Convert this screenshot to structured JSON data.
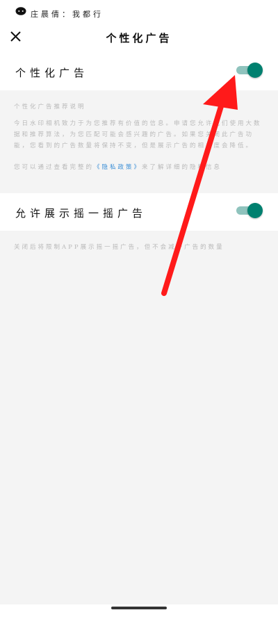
{
  "status_bar": {
    "text": "庄晨倩：我都行"
  },
  "navbar": {
    "title": "个性化广告"
  },
  "personalized_ads": {
    "label": "个性化广告",
    "toggle_on": true
  },
  "description": {
    "heading": "个性化广告推荐说明",
    "body": "今日水印相机致力于为您推荐有价值的信息。申请您允许我们使用大数据和推荐算法，为您匹配可能会感兴趣的广告。如果您关闭此广告功能，您看到的广告数量将保持不变，但是展示广告的相关度会降低。",
    "privacy_prefix": "您可以通过查看完整的",
    "privacy_link": "《隐私政策》",
    "privacy_suffix": "来了解详细的隐私信息"
  },
  "shake_ads": {
    "label": "允许展示摇一摇广告",
    "toggle_on": true,
    "description": "关闭后将限制APP展示摇一摇广告，但不会减少广告的数量"
  },
  "colors": {
    "toggle_thumb": "#00806f",
    "toggle_track": "#8fc3bd",
    "arrow": "#ff1a1a",
    "link": "#3a8ed6"
  }
}
